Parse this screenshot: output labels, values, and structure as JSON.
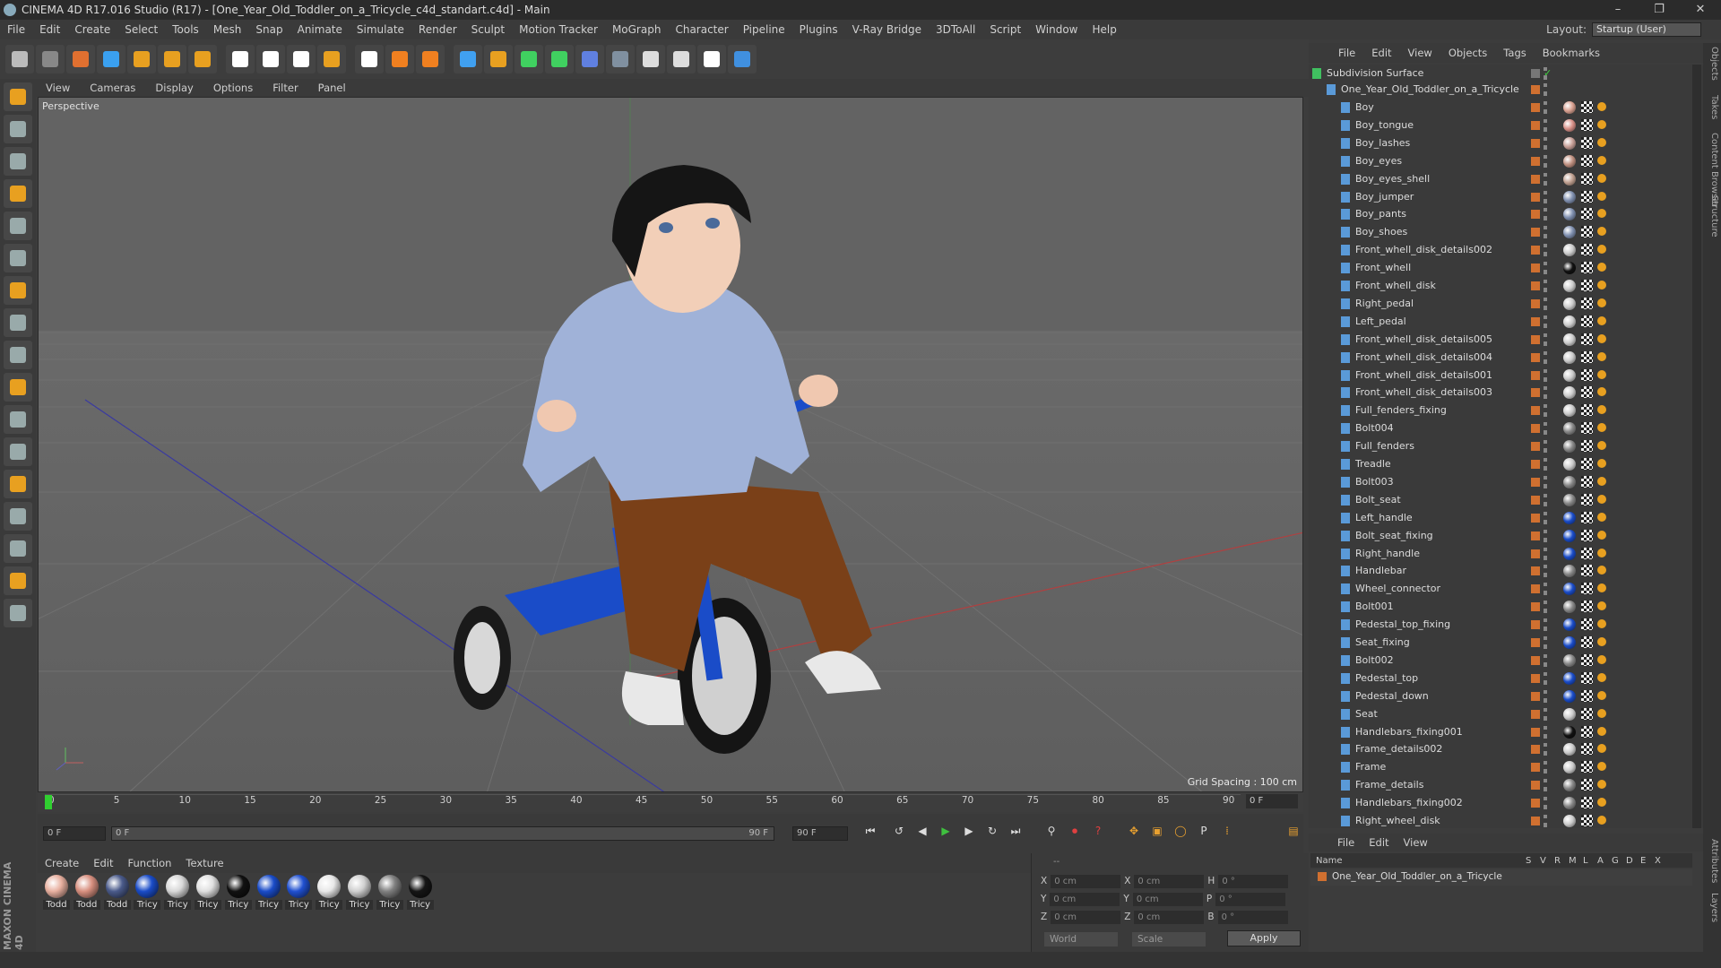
{
  "window": {
    "title": "CINEMA 4D R17.016 Studio (R17) - [One_Year_Old_Toddler_on_a_Tricycle_c4d_standart.c4d] - Main",
    "controls": [
      "–",
      "❐",
      "✕"
    ]
  },
  "menubar": [
    "File",
    "Edit",
    "Create",
    "Select",
    "Tools",
    "Mesh",
    "Snap",
    "Animate",
    "Simulate",
    "Render",
    "Sculpt",
    "Motion Tracker",
    "MoGraph",
    "Character",
    "Pipeline",
    "Plugins",
    "V-Ray Bridge",
    "3DToAll",
    "Script",
    "Window",
    "Help"
  ],
  "layout": {
    "label": "Layout:",
    "value": "Startup (User)"
  },
  "toolbar_icons": [
    "undo-icon",
    "redo-icon",
    "selection-icon",
    "move-icon",
    "scale-icon",
    "rotate-icon",
    "add-icon",
    "x-axis-icon",
    "y-axis-icon",
    "z-axis-icon",
    "coordinate-system-icon",
    "render-view-icon",
    "render-picture-viewer-icon",
    "edit-render-settings-icon",
    "cube-icon",
    "pen-spline-icon",
    "subdivision-icon",
    "array-icon",
    "deformer-icon",
    "floor-icon",
    "camera-icon",
    "light-icon",
    "v-ray-icon",
    "python-icon"
  ],
  "viewport": {
    "menu": [
      "View",
      "Cameras",
      "Display",
      "Options",
      "Filter",
      "Panel"
    ],
    "label": "Perspective",
    "grid_spacing": "Grid Spacing : 100 cm"
  },
  "timeline": {
    "ticks": [
      "0",
      "5",
      "10",
      "15",
      "20",
      "25",
      "30",
      "35",
      "40",
      "45",
      "50",
      "55",
      "60",
      "65",
      "70",
      "75",
      "80",
      "85",
      "90"
    ],
    "current_frame": "0 F"
  },
  "transport": {
    "start_field": "0 F",
    "range_start": "0 F",
    "range_end": "90 F",
    "end_field": "90 F"
  },
  "materials": {
    "menu": [
      "Create",
      "Edit",
      "Function",
      "Texture"
    ],
    "items": [
      {
        "name": "Todd",
        "color": "#e8b0a0"
      },
      {
        "name": "Todd",
        "color": "#d89080"
      },
      {
        "name": "Todd",
        "color": "#4a5a8a"
      },
      {
        "name": "Tricy",
        "color": "#1a4cc8"
      },
      {
        "name": "Tricy",
        "color": "#d8d8d8"
      },
      {
        "name": "Tricy",
        "color": "#e0e0e0"
      },
      {
        "name": "Tricy",
        "color": "#111111"
      },
      {
        "name": "Tricy",
        "color": "#1a4cc8"
      },
      {
        "name": "Tricy",
        "color": "#2050d0"
      },
      {
        "name": "Tricy",
        "color": "#e8e8e8"
      },
      {
        "name": "Tricy",
        "color": "#d0d0d0"
      },
      {
        "name": "Tricy",
        "color": "#808080"
      },
      {
        "name": "Tricy",
        "color": "#151515"
      }
    ]
  },
  "brand": "MAXON CINEMA 4D",
  "coordinates": {
    "header": "--",
    "rows": [
      {
        "a": "X",
        "av": "0 cm",
        "b": "X",
        "bv": "0 cm",
        "c": "H",
        "cv": "0 °"
      },
      {
        "a": "Y",
        "av": "0 cm",
        "b": "Y",
        "bv": "0 cm",
        "c": "P",
        "cv": "0 °"
      },
      {
        "a": "Z",
        "av": "0 cm",
        "b": "Z",
        "bv": "0 cm",
        "c": "B",
        "cv": "0 °"
      }
    ],
    "world": "World",
    "scale": "Scale",
    "apply": "Apply"
  },
  "object_manager": {
    "menu": [
      "File",
      "Edit",
      "View",
      "Objects",
      "Tags",
      "Bookmarks"
    ],
    "root": "Subdivision Surface",
    "group": "One_Year_Old_Toddler_on_a_Tricycle",
    "objects": [
      {
        "name": "Boy",
        "tag": "#d8a090"
      },
      {
        "name": "Boy_tongue",
        "tag": "#d89088"
      },
      {
        "name": "Boy_lashes",
        "tag": "#c8a098"
      },
      {
        "name": "Boy_eyes",
        "tag": "#c09080"
      },
      {
        "name": "Boy_eyes_shell",
        "tag": "#c0a090"
      },
      {
        "name": "Boy_jumper",
        "tag": "#8090b0"
      },
      {
        "name": "Boy_pants",
        "tag": "#8090b0"
      },
      {
        "name": "Boy_shoes",
        "tag": "#8090b0"
      },
      {
        "name": "Front_whell_disk_details002",
        "tag": "#cccccc"
      },
      {
        "name": "Front_whell",
        "tag": "#111111"
      },
      {
        "name": "Front_whell_disk",
        "tag": "#cccccc"
      },
      {
        "name": "Right_pedal",
        "tag": "#cccccc"
      },
      {
        "name": "Left_pedal",
        "tag": "#cccccc"
      },
      {
        "name": "Front_whell_disk_details005",
        "tag": "#cccccc"
      },
      {
        "name": "Front_whell_disk_details004",
        "tag": "#cccccc"
      },
      {
        "name": "Front_whell_disk_details001",
        "tag": "#cccccc"
      },
      {
        "name": "Front_whell_disk_details003",
        "tag": "#cccccc"
      },
      {
        "name": "Full_fenders_fixing",
        "tag": "#cccccc"
      },
      {
        "name": "Bolt004",
        "tag": "#888888"
      },
      {
        "name": "Full_fenders",
        "tag": "#888888"
      },
      {
        "name": "Treadle",
        "tag": "#cccccc"
      },
      {
        "name": "Bolt003",
        "tag": "#888888"
      },
      {
        "name": "Bolt_seat",
        "tag": "#888888"
      },
      {
        "name": "Left_handle",
        "tag": "#1a4cc8"
      },
      {
        "name": "Bolt_seat_fixing",
        "tag": "#1a4cc8"
      },
      {
        "name": "Right_handle",
        "tag": "#1a4cc8"
      },
      {
        "name": "Handlebar",
        "tag": "#888888"
      },
      {
        "name": "Wheel_connector",
        "tag": "#1a4cc8"
      },
      {
        "name": "Bolt001",
        "tag": "#888888"
      },
      {
        "name": "Pedestal_top_fixing",
        "tag": "#1a4cc8"
      },
      {
        "name": "Seat_fixing",
        "tag": "#1a4cc8"
      },
      {
        "name": "Bolt002",
        "tag": "#888888"
      },
      {
        "name": "Pedestal_top",
        "tag": "#1a4cc8"
      },
      {
        "name": "Pedestal_down",
        "tag": "#1a4cc8"
      },
      {
        "name": "Seat",
        "tag": "#cccccc"
      },
      {
        "name": "Handlebars_fixing001",
        "tag": "#111111"
      },
      {
        "name": "Frame_details002",
        "tag": "#cccccc"
      },
      {
        "name": "Frame",
        "tag": "#cccccc"
      },
      {
        "name": "Frame_details",
        "tag": "#888888"
      },
      {
        "name": "Handlebars_fixing002",
        "tag": "#888888"
      },
      {
        "name": "Right_wheel_disk",
        "tag": "#cccccc"
      }
    ]
  },
  "side_tabs": [
    "Objects",
    "Takes",
    "Content Browser",
    "Structure",
    "Attributes",
    "Layers"
  ],
  "layer_manager": {
    "menu": [
      "File",
      "Edit",
      "View"
    ],
    "columns": [
      "Name",
      "S",
      "V",
      "R",
      "M",
      "L",
      "A",
      "G",
      "D",
      "E",
      "X"
    ],
    "row": "One_Year_Old_Toddler_on_a_Tricycle"
  }
}
